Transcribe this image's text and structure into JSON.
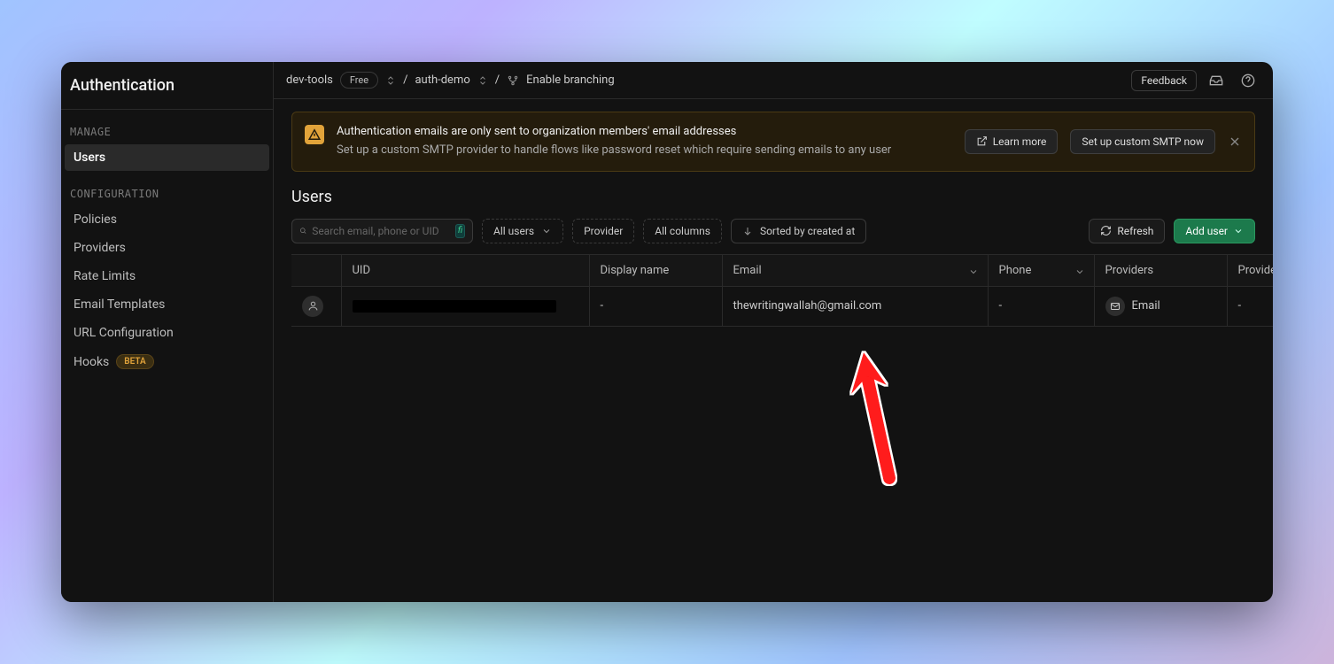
{
  "sidebar": {
    "title": "Authentication",
    "sections": [
      {
        "label": "MANAGE",
        "items": [
          {
            "label": "Users",
            "active": true
          }
        ]
      },
      {
        "label": "CONFIGURATION",
        "items": [
          {
            "label": "Policies"
          },
          {
            "label": "Providers"
          },
          {
            "label": "Rate Limits"
          },
          {
            "label": "Email Templates"
          },
          {
            "label": "URL Configuration"
          },
          {
            "label": "Hooks",
            "badge": "BETA"
          }
        ]
      }
    ]
  },
  "topbar": {
    "org": "dev-tools",
    "plan": "Free",
    "project": "auth-demo",
    "branching": "Enable branching",
    "feedback": "Feedback"
  },
  "banner": {
    "line1": "Authentication emails are only sent to organization members' email addresses",
    "line2": "Set up a custom SMTP provider to handle flows like password reset which require sending emails to any user",
    "learn": "Learn more",
    "setup": "Set up custom SMTP now"
  },
  "page": {
    "title": "Users"
  },
  "toolbar": {
    "search_placeholder": "Search email, phone or UID",
    "kbd": "fi",
    "all_users": "All users",
    "provider": "Provider",
    "all_columns": "All columns",
    "sort": "Sorted by created at",
    "refresh": "Refresh",
    "add_user": "Add user"
  },
  "table": {
    "headers": {
      "uid": "UID",
      "display_name": "Display name",
      "email": "Email",
      "phone": "Phone",
      "providers": "Providers",
      "provider_type": "Provider ty"
    },
    "rows": [
      {
        "uid_redacted": true,
        "display_name": "-",
        "email": "thewritingwallah@gmail.com",
        "phone": "-",
        "provider_label": "Email",
        "provider_type": "-"
      }
    ]
  }
}
